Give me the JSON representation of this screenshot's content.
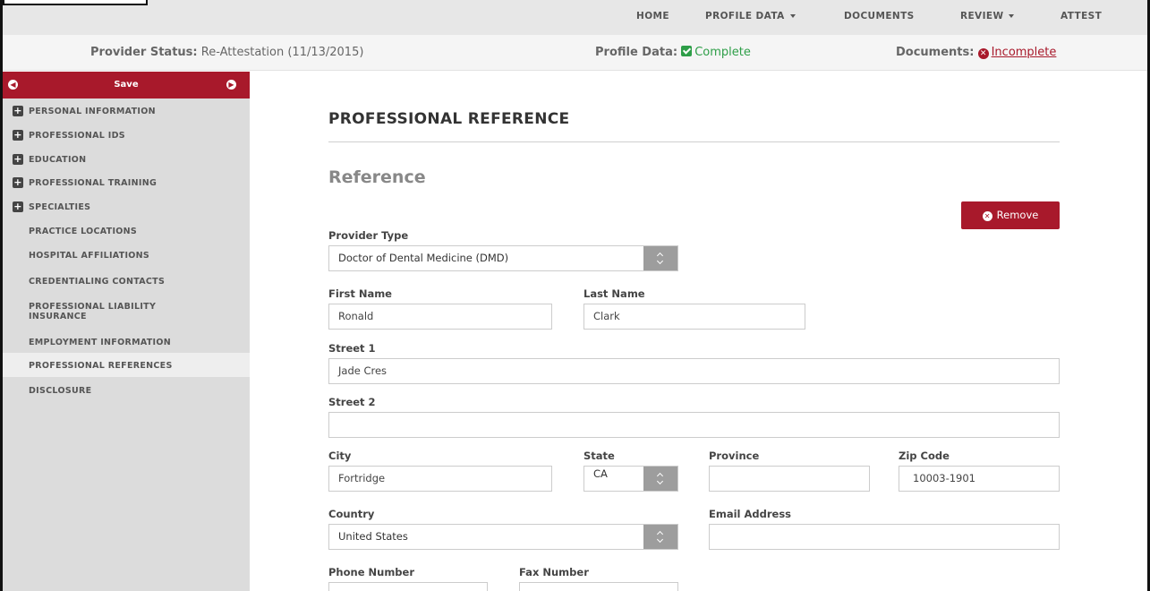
{
  "nav": {
    "home": "HOME",
    "profile_data": "PROFILE DATA",
    "documents": "DOCUMENTS",
    "review": "REVIEW",
    "attest": "ATTEST"
  },
  "status": {
    "provider_label": "Provider Status:",
    "provider_value": "Re-Attestation (11/13/2015)",
    "profile_label": "Profile Data:",
    "profile_value": "Complete",
    "documents_label": "Documents:",
    "documents_value": "Incomplete"
  },
  "sidebar": {
    "save_label": "Save",
    "items": [
      {
        "label": "PERSONAL INFORMATION",
        "expandable": true
      },
      {
        "label": "PROFESSIONAL IDS",
        "expandable": true
      },
      {
        "label": "EDUCATION",
        "expandable": true
      },
      {
        "label": "PROFESSIONAL TRAINING",
        "expandable": true
      },
      {
        "label": "SPECIALTIES",
        "expandable": true
      },
      {
        "label": "PRACTICE LOCATIONS",
        "expandable": false
      },
      {
        "label": "HOSPITAL AFFILIATIONS",
        "expandable": false
      },
      {
        "label": "CREDENTIALING CONTACTS",
        "expandable": false
      },
      {
        "label": "PROFESSIONAL LIABILITY INSURANCE",
        "expandable": false
      },
      {
        "label": "EMPLOYMENT INFORMATION",
        "expandable": false
      },
      {
        "label": "PROFESSIONAL REFERENCES",
        "expandable": false,
        "active": true
      },
      {
        "label": "DISCLOSURE",
        "expandable": false
      }
    ]
  },
  "main": {
    "section_title": "PROFESSIONAL REFERENCE",
    "subtitle": "Reference",
    "remove_label": "Remove",
    "fields": {
      "provider_type": {
        "label": "Provider Type",
        "value": "Doctor of Dental Medicine (DMD)"
      },
      "first_name": {
        "label": "First Name",
        "value": "Ronald"
      },
      "last_name": {
        "label": "Last Name",
        "value": "Clark"
      },
      "street1": {
        "label": "Street 1",
        "value": "Jade Cres"
      },
      "street2": {
        "label": "Street 2",
        "value": ""
      },
      "city": {
        "label": "City",
        "value": "Fortridge"
      },
      "state": {
        "label": "State",
        "value": "CA"
      },
      "province": {
        "label": "Province",
        "value": ""
      },
      "zip": {
        "label": "Zip Code",
        "value": "10003-1901"
      },
      "country": {
        "label": "Country",
        "value": "United States"
      },
      "email": {
        "label": "Email Address",
        "value": ""
      },
      "phone": {
        "label": "Phone Number",
        "value": ""
      },
      "fax": {
        "label": "Fax Number",
        "value": ""
      }
    }
  },
  "colors": {
    "accent": "#a8192b",
    "success": "#2e9e48",
    "sidebar_bg": "#dcdcdc",
    "nav_bg": "#e7e7e7"
  }
}
